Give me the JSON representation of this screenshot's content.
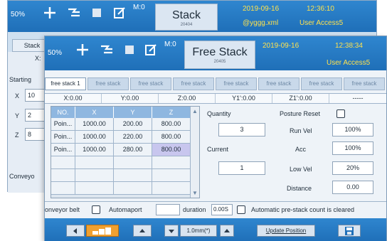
{
  "back_window": {
    "header": {
      "battery_percent": "50%",
      "mode": "M:0",
      "title": "Stack",
      "subtitle": "20404",
      "date": "2019-09-16",
      "time": "12:36:10",
      "file": "@yggg.xml",
      "user": "User Access5"
    },
    "tab_label": "Stack",
    "panel": {
      "x_prefix": "X:",
      "starting_label": "Starting",
      "x_label": "X",
      "x_value": "10",
      "y_label": "Y",
      "y_value": "2",
      "z_label": "Z",
      "z_value": "8",
      "conveyor_label": "Conveyo"
    }
  },
  "front_window": {
    "header": {
      "battery_percent": "50%",
      "mode": "M:0",
      "title": "Free Stack",
      "subtitle": "20405",
      "date": "2019-09-16",
      "time": "12:38:34",
      "user": "User Access5"
    },
    "tabs": [
      "free stack 1",
      "free stack",
      "free stack",
      "free stack",
      "free stack",
      "free stack",
      "free stack",
      "free stack"
    ],
    "coords": [
      {
        "label": "X:0.00"
      },
      {
        "label": "Y:0.00"
      },
      {
        "label": "Z:0.00"
      },
      {
        "label": "Y1':0.00"
      },
      {
        "label": "Z1':0.00"
      },
      {
        "label": "-----"
      }
    ],
    "table": {
      "headers": [
        "NO.",
        "X",
        "Y",
        "Z"
      ],
      "rows": [
        {
          "no": "Poin...",
          "x": "1000.00",
          "y": "200.00",
          "z": "800.00"
        },
        {
          "no": "Poin...",
          "x": "1000.00",
          "y": "220.00",
          "z": "800.00"
        },
        {
          "no": "Poin...",
          "x": "1000.00",
          "y": "280.00",
          "z": "800.00"
        }
      ]
    },
    "right_panel": {
      "quantity_label": "Quantity",
      "quantity_value": "3",
      "current_label": "Current",
      "current_value": "1",
      "posture_reset_label": "Posture Reset",
      "run_vel_label": "Run Vel",
      "run_vel_value": "100%",
      "acc_label": "Acc",
      "acc_value": "100%",
      "low_vel_label": "Low Vel",
      "low_vel_value": "20%",
      "distance_label": "Distance",
      "distance_value": "0.00"
    },
    "options": {
      "conveyor_belt_label": "onveyor belt",
      "automaport_label": "Automaport",
      "duration_label": "duration",
      "duration_value": "0.00S",
      "auto_prestack_label": "Automatic pre-stack count is cleared"
    },
    "bottom": {
      "speed_label": "1.0mm(*)",
      "update_position_label": "Update Position"
    }
  },
  "colors": {
    "header_blue": "#1f6fb8",
    "table_header": "#8fb7e0",
    "highlight_cell": "#c8c6ee",
    "date_yellow": "#ffe24d"
  }
}
